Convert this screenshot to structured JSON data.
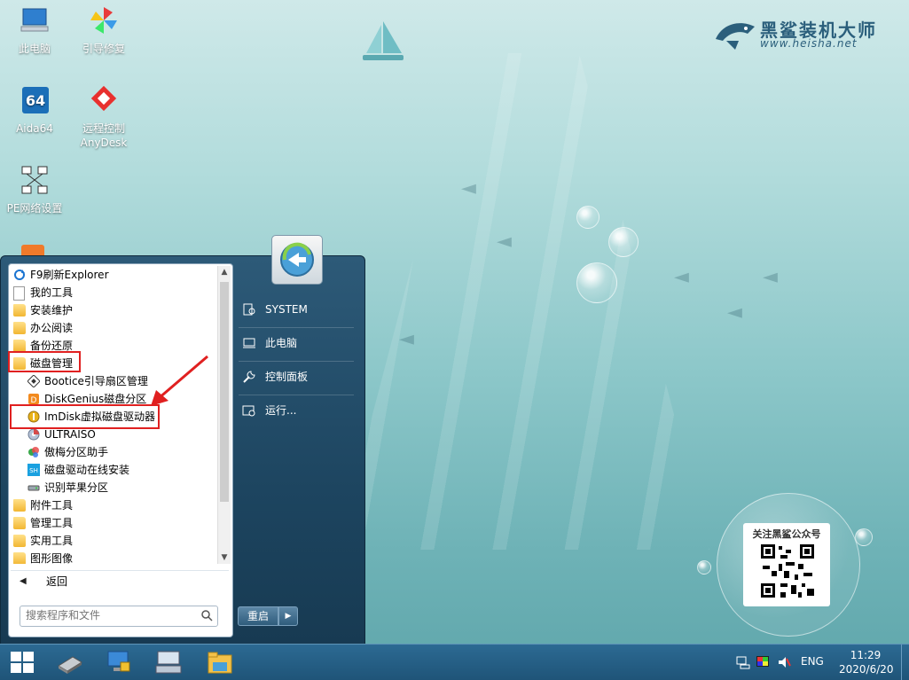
{
  "desktop": {
    "icons": [
      {
        "label": "此电脑",
        "icon": "computer-icon"
      },
      {
        "label": "引导修复",
        "icon": "pinwheel-icon"
      },
      {
        "label": "Aida64",
        "icon": "aida64-icon"
      },
      {
        "label": "远程控制\nAnyDesk",
        "line1": "远程控制",
        "line2": "AnyDesk",
        "icon": "anydesk-icon"
      },
      {
        "label": "PE网络设置",
        "icon": "network-icon"
      }
    ]
  },
  "logo": {
    "brand": "黑鲨装机大师",
    "url": "www.heisha.net"
  },
  "start_menu": {
    "programs": [
      {
        "label": "F9刷新Explorer",
        "icon": "refresh-icon",
        "level": 0
      },
      {
        "label": "我的工具",
        "icon": "document-icon",
        "level": 0
      },
      {
        "label": "安装维护",
        "icon": "folder-icon",
        "level": 0
      },
      {
        "label": "办公阅读",
        "icon": "folder-icon",
        "level": 0
      },
      {
        "label": "备份还原",
        "icon": "folder-icon",
        "level": 0
      },
      {
        "label": "磁盘管理",
        "icon": "folder-icon",
        "level": 0
      },
      {
        "label": "Bootice引导扇区管理",
        "icon": "bootice-icon",
        "level": 1
      },
      {
        "label": "DiskGenius磁盘分区",
        "icon": "diskgenius-icon",
        "level": 1
      },
      {
        "label": "ImDisk虚拟磁盘驱动器",
        "icon": "imdisk-icon",
        "level": 1
      },
      {
        "label": "ULTRAISO",
        "icon": "ultraiso-icon",
        "level": 1
      },
      {
        "label": "傲梅分区助手",
        "icon": "aomei-icon",
        "level": 1
      },
      {
        "label": "磁盘驱动在线安装",
        "icon": "driver-icon",
        "level": 1
      },
      {
        "label": "识别苹果分区",
        "icon": "apple-partition-icon",
        "level": 1
      },
      {
        "label": "附件工具",
        "icon": "folder-icon",
        "level": 0
      },
      {
        "label": "管理工具",
        "icon": "folder-icon",
        "level": 0
      },
      {
        "label": "实用工具",
        "icon": "folder-icon",
        "level": 0
      },
      {
        "label": "图形图像",
        "icon": "folder-icon",
        "level": 0
      }
    ],
    "back_label": "返回",
    "search_placeholder": "搜索程序和文件",
    "right_items": [
      {
        "label": "SYSTEM",
        "icon": "user-icon"
      },
      {
        "label": "此电脑",
        "icon": "computer-icon"
      },
      {
        "label": "控制面板",
        "icon": "wrench-icon"
      },
      {
        "label": "运行...",
        "icon": "run-icon"
      }
    ],
    "shutdown_label": "重启"
  },
  "qr": {
    "title": "关注黑鲨公众号"
  },
  "taskbar": {
    "language": "ENG",
    "time": "11:29",
    "date": "2020/6/20"
  },
  "colors": {
    "accent": "#1f5478",
    "annotation": "#e02020",
    "folder": "#f2b632"
  }
}
